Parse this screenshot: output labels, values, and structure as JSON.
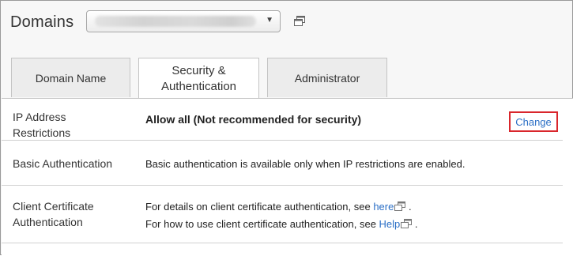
{
  "header": {
    "title": "Domains",
    "domain_select": {
      "value": "",
      "caret_icon": "chevron-down-icon"
    },
    "open_new_window_icon": "open-in-new-window-icon"
  },
  "tabs": [
    {
      "label": "Domain Name",
      "active": false
    },
    {
      "label_line1": "Security &",
      "label_line2": "Authentication",
      "active": true
    },
    {
      "label": "Administrator",
      "active": false
    }
  ],
  "settings": {
    "ip_restrictions": {
      "label_line1": "IP Address",
      "label_line2": "Restrictions",
      "value": "Allow all (Not recommended for security)",
      "action_label": "Change"
    },
    "basic_auth": {
      "label": "Basic Authentication",
      "value": "Basic authentication is available only when IP restrictions are enabled."
    },
    "client_cert": {
      "label_line1": "Client Certificate",
      "label_line2": "Authentication",
      "line1_text": "For details on client certificate authentication, see ",
      "line1_link": "here",
      "line1_suffix": " .",
      "line2_text": "For how to use client certificate authentication, see ",
      "line2_link": "Help",
      "line2_suffix": " ."
    }
  },
  "colors": {
    "link": "#2b6fc6",
    "highlight_border": "#d9262c",
    "tab_inactive": "#ececec"
  }
}
